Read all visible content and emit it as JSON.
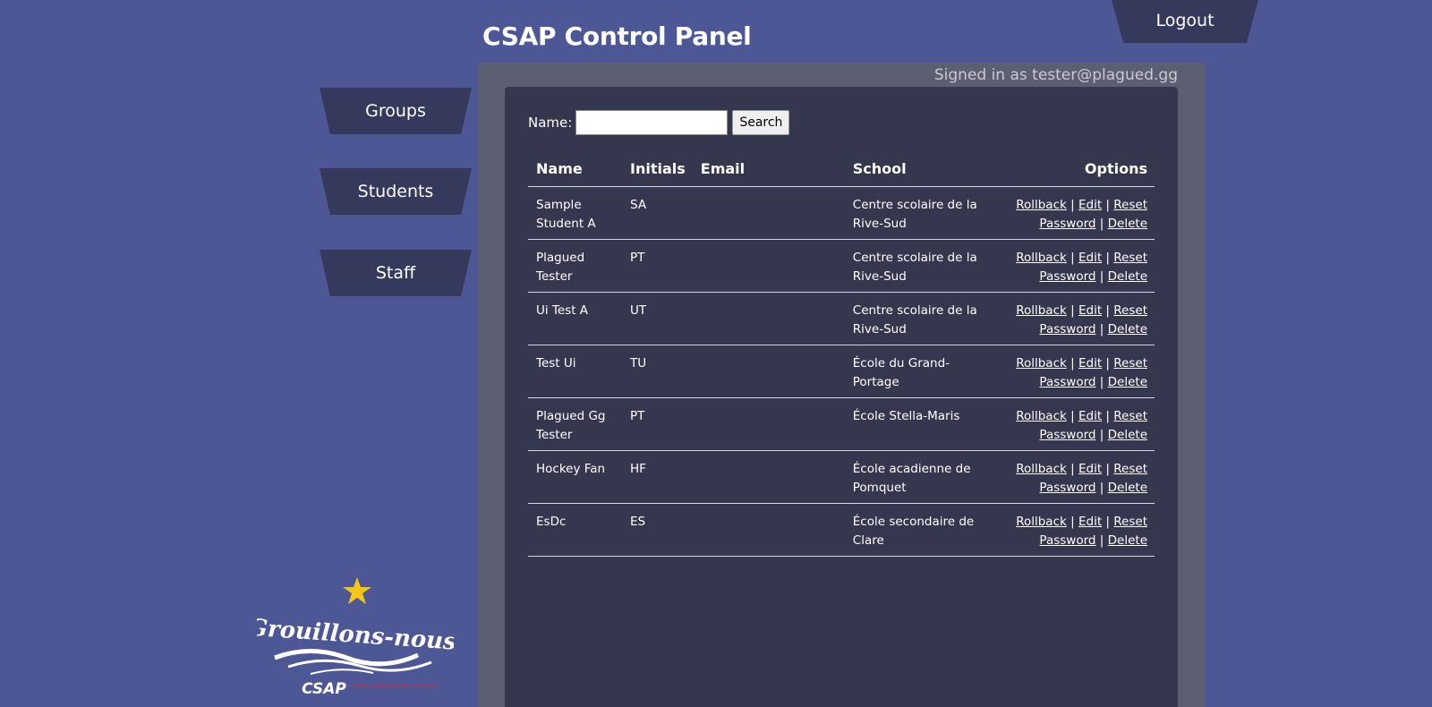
{
  "header": {
    "title": "CSAP Control Panel",
    "logout_label": "Logout"
  },
  "nav": {
    "items": [
      {
        "label": "Groups"
      },
      {
        "label": "Students"
      },
      {
        "label": "Staff"
      }
    ]
  },
  "account": {
    "signed_in_text": "Signed in as tester@plagued.gg"
  },
  "search": {
    "label": "Name:",
    "value": "",
    "placeholder": "",
    "button_label": "Search"
  },
  "table": {
    "headers": {
      "name": "Name",
      "initials": "Initials",
      "email": "Email",
      "school": "School",
      "options": "Options"
    },
    "option_labels": {
      "rollback": "Rollback",
      "edit": "Edit",
      "reset_password": "Reset Password",
      "delete": "Delete",
      "separator": "|"
    },
    "rows": [
      {
        "name": "Sample Student A",
        "initials": "SA",
        "email": "",
        "school": "Centre scolaire de la Rive-Sud"
      },
      {
        "name": "Plagued Tester",
        "initials": "PT",
        "email": "",
        "school": "Centre scolaire de la Rive-Sud"
      },
      {
        "name": "Ui Test A",
        "initials": "UT",
        "email": "",
        "school": "Centre scolaire de la Rive-Sud"
      },
      {
        "name": "Test Ui",
        "initials": "TU",
        "email": "",
        "school": "École du Grand-Portage"
      },
      {
        "name": "Plagued Gg Tester",
        "initials": "PT",
        "email": "",
        "school": "École Stella-Maris"
      },
      {
        "name": "Hockey Fan",
        "initials": "HF",
        "email": "",
        "school": "École acadienne de Pomquet"
      },
      {
        "name": "EsDc",
        "initials": "ES",
        "email": "",
        "school": "École secondaire de Clare"
      }
    ]
  },
  "logo": {
    "tagline": "Grouillons-nous!",
    "brand": "CSAP",
    "brand_subtext": "Conseil scolaire acadien provincial",
    "star_color": "#f5c518"
  }
}
